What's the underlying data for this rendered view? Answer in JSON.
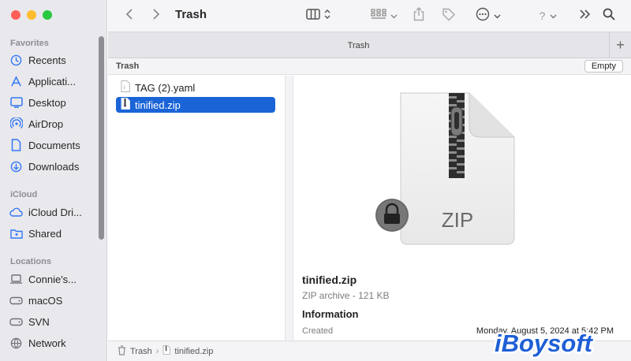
{
  "window": {
    "title": "Trash"
  },
  "sidebar": {
    "favorites_header": "Favorites",
    "favorites": [
      {
        "label": "Recents",
        "icon": "clock-icon"
      },
      {
        "label": "Applicati...",
        "icon": "applications-icon"
      },
      {
        "label": "Desktop",
        "icon": "desktop-icon"
      },
      {
        "label": "AirDrop",
        "icon": "airdrop-icon"
      },
      {
        "label": "Documents",
        "icon": "document-icon"
      },
      {
        "label": "Downloads",
        "icon": "download-icon"
      }
    ],
    "icloud_header": "iCloud",
    "icloud": [
      {
        "label": "iCloud Dri...",
        "icon": "cloud-icon"
      },
      {
        "label": "Shared",
        "icon": "shared-folder-icon"
      }
    ],
    "locations_header": "Locations",
    "locations": [
      {
        "label": "Connie's...",
        "icon": "laptop-icon"
      },
      {
        "label": "macOS",
        "icon": "disk-icon"
      },
      {
        "label": "SVN",
        "icon": "disk-icon"
      },
      {
        "label": "Network",
        "icon": "globe-icon"
      }
    ]
  },
  "tabbar": {
    "tab_label": "Trash",
    "add_label": "+"
  },
  "pathhead": {
    "label": "Trash",
    "empty_button": "Empty"
  },
  "files": [
    {
      "name": "TAG (2).yaml",
      "selected": false
    },
    {
      "name": "tinified.zip",
      "selected": true
    }
  ],
  "preview": {
    "icon_text": "ZIP",
    "name": "tinified.zip",
    "kind": "ZIP archive - 121 KB",
    "info_header": "Information",
    "created_label": "Created",
    "created_value": "Monday, August 5, 2024 at 5:42 PM"
  },
  "pathbar": {
    "segments": [
      "Trash",
      "tinified.zip"
    ],
    "separator": "›"
  },
  "watermark": {
    "text": "iBoysoft"
  },
  "colors": {
    "selection": "#1a64d7",
    "accent_blue": "#1a64d7",
    "watermark": "#1f5fd6"
  }
}
